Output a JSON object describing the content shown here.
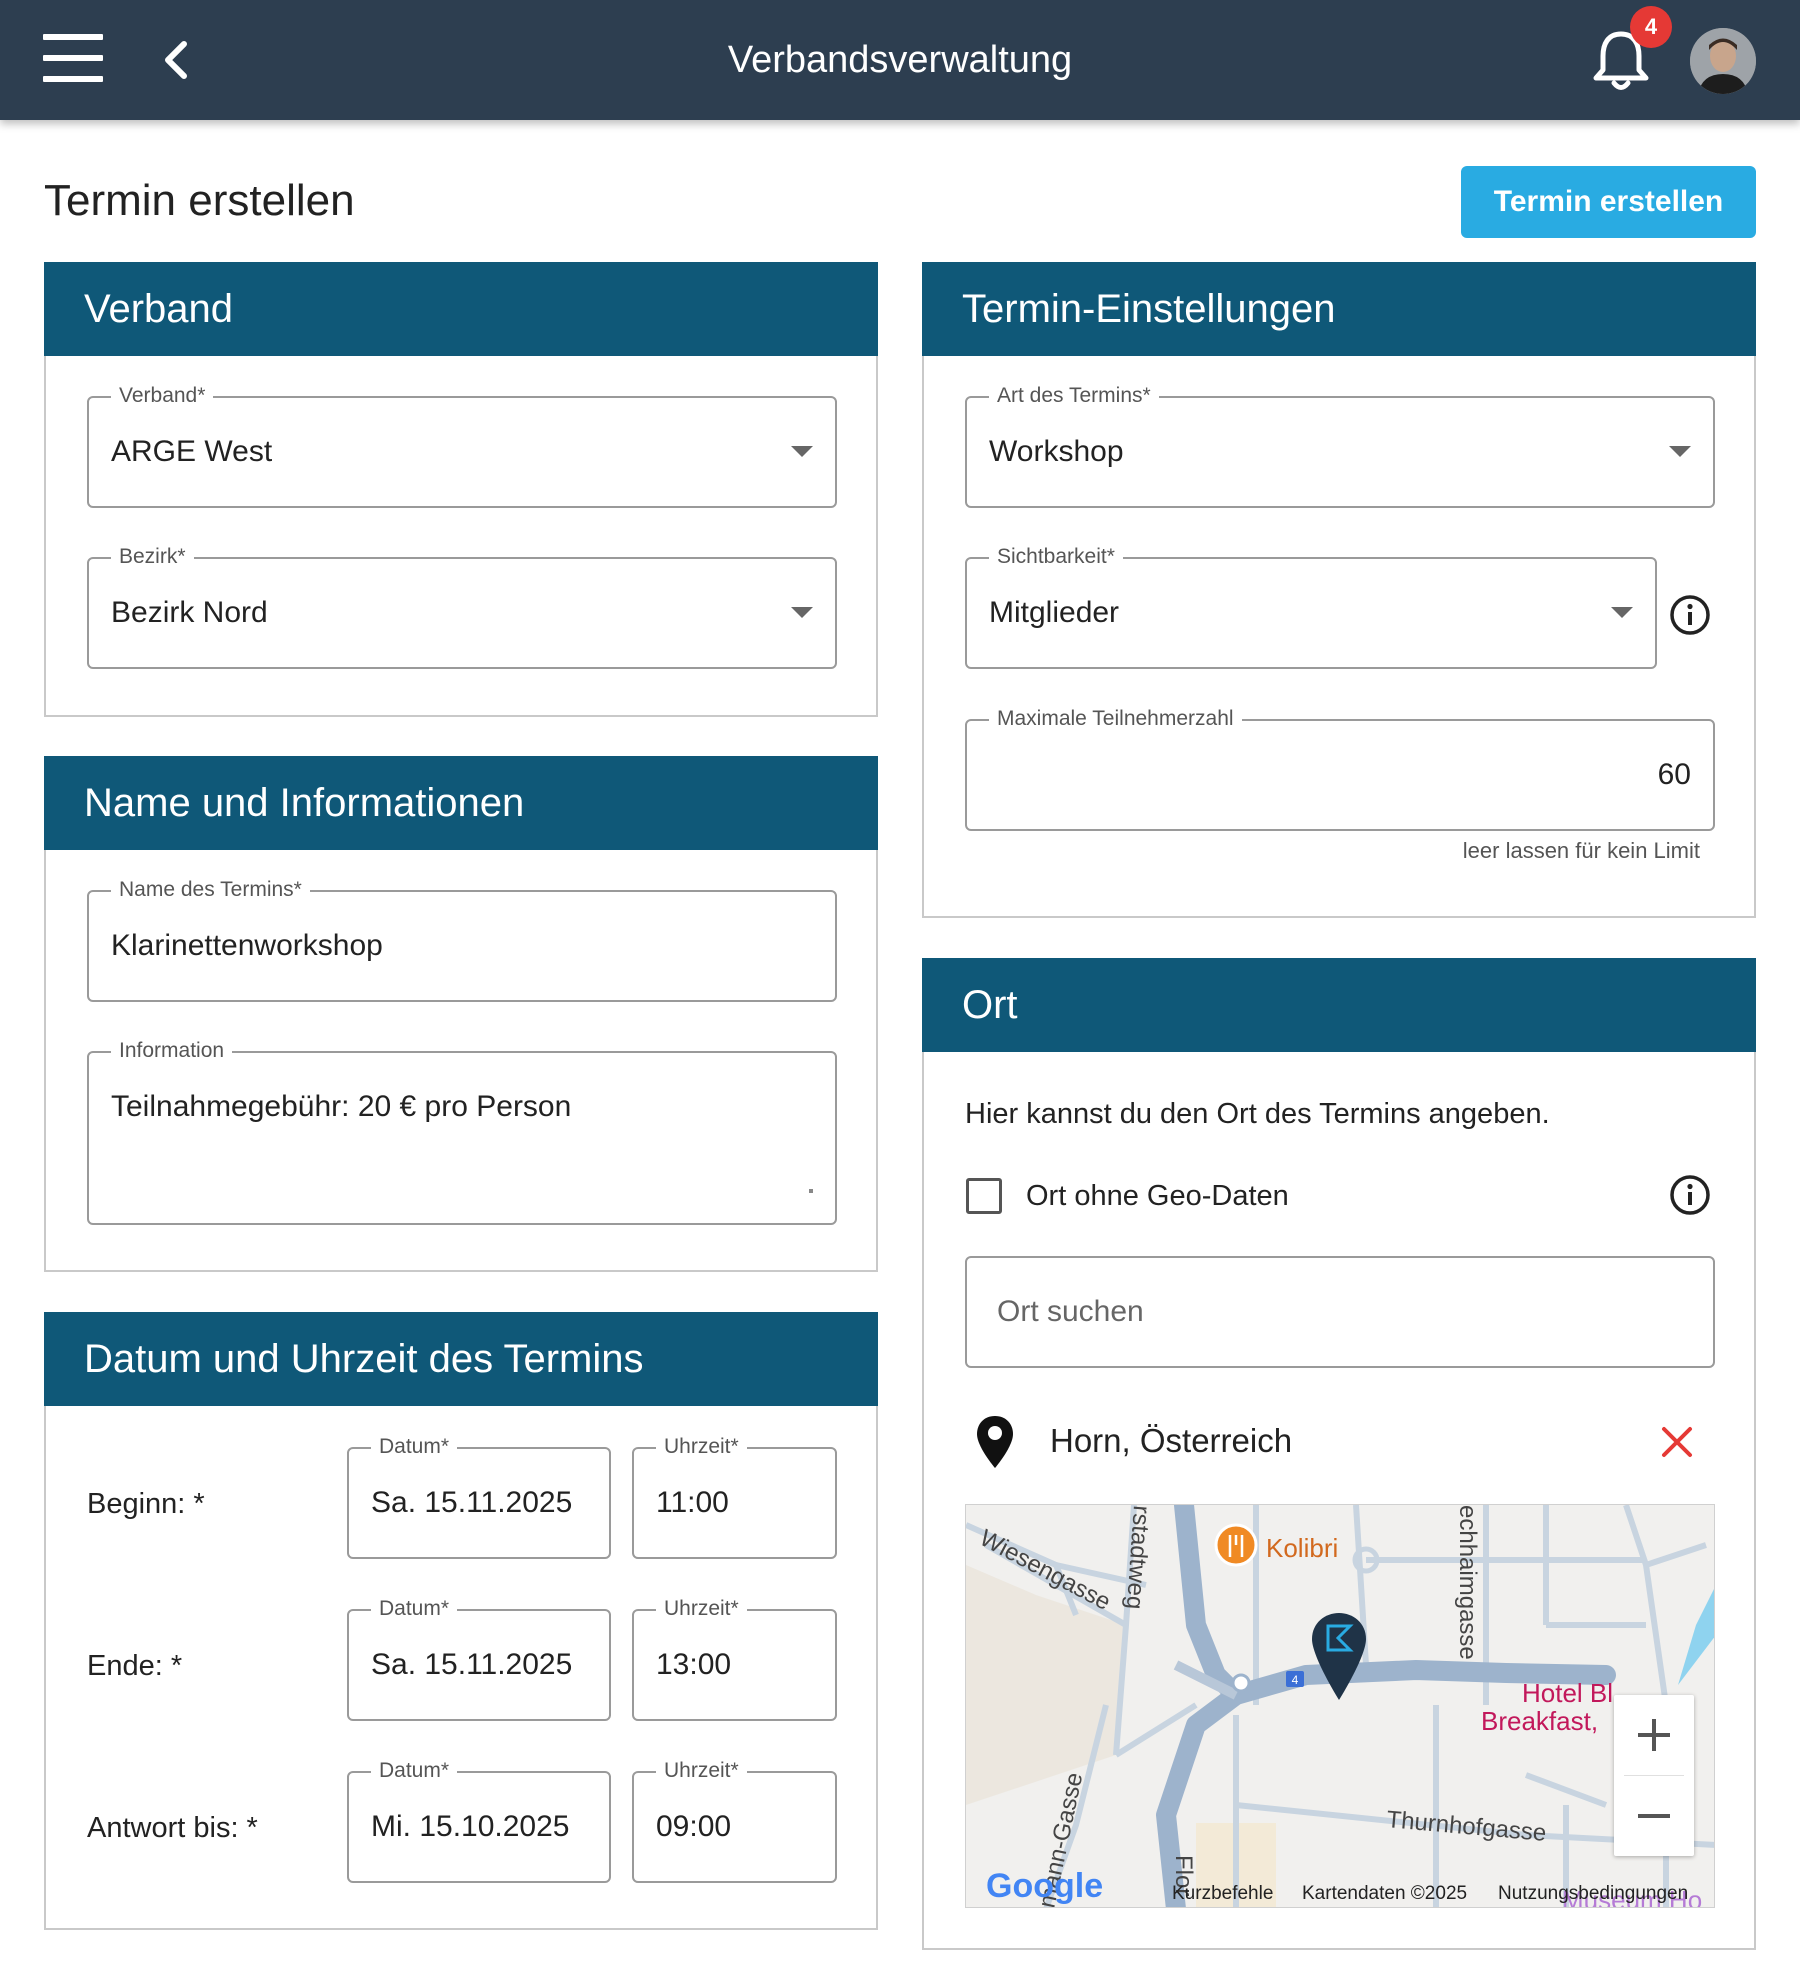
{
  "appbar": {
    "title": "Verbandsverwaltung",
    "notification_count": "4"
  },
  "page": {
    "title": "Termin erstellen",
    "create_button": "Termin erstellen"
  },
  "verband_card": {
    "title": "Verband",
    "verband": {
      "label": "Verband*",
      "value": "ARGE West"
    },
    "bezirk": {
      "label": "Bezirk*",
      "value": "Bezirk Nord"
    }
  },
  "name_card": {
    "title": "Name und Informationen",
    "name": {
      "label": "Name des Termins*",
      "value": "Klarinettenworkshop"
    },
    "info": {
      "label": "Information",
      "value": "Teilnahmegebühr: 20 € pro Person"
    }
  },
  "datetime_card": {
    "title": "Datum und Uhrzeit des Termins",
    "rows": [
      {
        "label": "Beginn: *",
        "date_label": "Datum*",
        "date": "Sa. 15.11.2025",
        "time_label": "Uhrzeit*",
        "time": "11:00"
      },
      {
        "label": "Ende: *",
        "date_label": "Datum*",
        "date": "Sa. 15.11.2025",
        "time_label": "Uhrzeit*",
        "time": "13:00"
      },
      {
        "label": "Antwort bis: *",
        "date_label": "Datum*",
        "date": "Mi. 15.10.2025",
        "time_label": "Uhrzeit*",
        "time": "09:00"
      }
    ]
  },
  "settings_card": {
    "title": "Termin-Einstellungen",
    "art": {
      "label": "Art des Termins*",
      "value": "Workshop"
    },
    "sichtbarkeit": {
      "label": "Sichtbarkeit*",
      "value": "Mitglieder"
    },
    "max": {
      "label": "Maximale Teilnehmerzahl",
      "value": "60",
      "helper": "leer lassen für kein Limit"
    }
  },
  "ort_card": {
    "title": "Ort",
    "intro": "Hier kannst du den Ort des Termins angeben.",
    "checkbox_label": "Ort ohne Geo-Daten",
    "search_placeholder": "Ort suchen",
    "selected_location": "Horn, Österreich",
    "map": {
      "streets": [
        "Wiesengasse",
        "rstadtweg",
        "echhaimgasse",
        "mann-Gasse",
        "Thurnhofgasse",
        "Flor"
      ],
      "poi": "Kolibri",
      "hotel_line1": "Hotel Bl",
      "hotel_line2": "Breakfast,",
      "museum": "Museum Ho",
      "route_number": "4",
      "google": "Google",
      "footer": [
        "Kurzbefehle",
        "Kartendaten ©2025",
        "Nutzungsbedingungen"
      ]
    }
  },
  "colors": {
    "appbar": "#2d3e50",
    "card_header": "#0f5878",
    "primary_button": "#29abe2",
    "badge": "#e53935",
    "remove_icon": "#e53935"
  }
}
